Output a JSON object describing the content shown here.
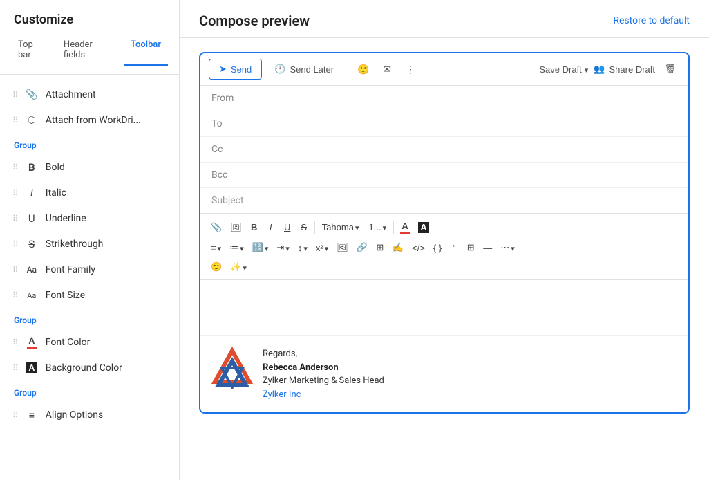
{
  "sidebar": {
    "title": "Customize",
    "tabs": [
      {
        "id": "topbar",
        "label": "Top bar",
        "active": false
      },
      {
        "id": "headerfields",
        "label": "Header fields",
        "active": false
      },
      {
        "id": "toolbar",
        "label": "Toolbar",
        "active": true
      }
    ],
    "groups": [
      {
        "id": "group1",
        "label": null,
        "items": [
          {
            "id": "attachment",
            "icon": "paperclip",
            "label": "Attachment"
          },
          {
            "id": "attach-workdrive",
            "icon": "workdrive",
            "label": "Attach from WorkDri..."
          }
        ]
      },
      {
        "id": "group2",
        "label": "Group",
        "items": [
          {
            "id": "bold",
            "icon": "B",
            "label": "Bold"
          },
          {
            "id": "italic",
            "icon": "I",
            "label": "Italic"
          },
          {
            "id": "underline",
            "icon": "U",
            "label": "Underline"
          },
          {
            "id": "strikethrough",
            "icon": "S",
            "label": "Strikethrough"
          }
        ]
      },
      {
        "id": "group3",
        "label": null,
        "items": [
          {
            "id": "font-family",
            "icon": "fontfamily",
            "label": "Font Family"
          },
          {
            "id": "font-size",
            "icon": "fontsize",
            "label": "Font Size"
          }
        ]
      },
      {
        "id": "group4",
        "label": "Group",
        "items": [
          {
            "id": "font-color",
            "icon": "fontcolor",
            "label": "Font Color"
          },
          {
            "id": "bg-color",
            "icon": "bgcolor",
            "label": "Background Color"
          }
        ]
      },
      {
        "id": "group5",
        "label": "Group",
        "items": [
          {
            "id": "align-options",
            "icon": "align",
            "label": "Align Options"
          }
        ]
      }
    ]
  },
  "main": {
    "title": "Compose preview",
    "restore_link": "Restore to default",
    "toolbar_top": {
      "send_label": "Send",
      "send_later_label": "Send Later",
      "save_draft_label": "Save Draft",
      "share_draft_label": "Share Draft"
    },
    "email": {
      "from_label": "From",
      "to_label": "To",
      "cc_label": "Cc",
      "bcc_label": "Bcc",
      "subject_label": "Subject",
      "font_selector": "Tahoma",
      "font_size": "1..."
    },
    "signature": {
      "regards": "Regards,",
      "name": "Rebecca Anderson",
      "title": "Zylker Marketing & Sales Head",
      "company_link": "Zylker Inc"
    }
  }
}
